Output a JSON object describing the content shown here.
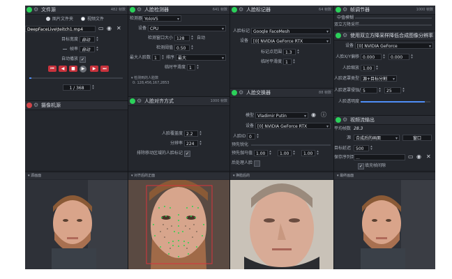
{
  "file_source": {
    "title": "文件源",
    "fps": "482 帧数",
    "radio_folder": "图片文件夹",
    "radio_video": "视频文件",
    "path_value": "DeepFaceLive\\teitch1.mp4",
    "target_width_label": "目标宽度",
    "target_width_value": "自动",
    "fps_label": "帧率",
    "fps_value": "自动",
    "autoplay_label": "自动播放",
    "frame_counter": "1 / 368"
  },
  "camera_source": {
    "title": "摄像机源"
  },
  "face_detector": {
    "title": "人脸检测器",
    "fps": "641 帧数",
    "detector_label": "检测器",
    "detector_value": "YoloV5",
    "device_label": "设备",
    "device_value": "CPU",
    "window_label": "检测窗口大小",
    "window_value": "128",
    "window_auto": "自动",
    "threshold_label": "检测阈值",
    "threshold_value": "0.50",
    "max_faces_label": "最大人脸数",
    "max_faces_value": "1",
    "sort_label": "排序",
    "sort_value": "最大",
    "temporal_label": "临时平滑度",
    "temporal_value": "1",
    "detected_label": "检测到的人脸数",
    "detected_value": "0: 128,456,167,2853"
  },
  "face_aligner": {
    "title": "人脸对齐方式",
    "fps": "1000 帧数",
    "coverage_label": "人脸覆盖度",
    "coverage_value": "2.2",
    "resolution_label": "分辨率",
    "resolution_value": "224",
    "exclude_label": "排除移动区域的人脸标记",
    "aligned_view": "对齐后的正面"
  },
  "face_marker": {
    "title": "人脸标记器",
    "fps": "64 帧数",
    "marker_label": "人脸标记",
    "marker_value": "Google FaceMesh",
    "device_label": "设备",
    "device_value": "[0] NVIDIA GeForce RTX",
    "range_label": "标记点范围",
    "range_value": "1.3",
    "temporal_label": "临时平滑度",
    "temporal_value": "1"
  },
  "face_swapper": {
    "title": "人脸交换器",
    "fps": "88 帧数",
    "model_label": "模型",
    "model_value": "Vladimir Putin",
    "device_label": "设备",
    "device_value": "[0] NVIDIA GeForce RTX",
    "face_id_label": "人脸ID",
    "face_id_value": "0",
    "morph_label": "预先锐化",
    "gamma_label": "预先伽马值",
    "gamma_values": [
      "1.00",
      "1.00",
      "1.00"
    ],
    "post_label": "后处理人脸",
    "swapped_view": "换脸后的"
  },
  "frame_adjuster": {
    "title": "帧调节器",
    "fps": "1000 帧数",
    "median_label": "中值模糊",
    "degrade_label": "双立方降采样",
    "merger_title": "使用双立方降采样降低合成图像分辨率",
    "device_label": "设备",
    "device_value": "[0] NVIDIA GeForce",
    "offset_label": "人脸X/Y偏移",
    "offset_x": "0.000",
    "offset_y": "0.000",
    "scale_label": "人脸缩放",
    "scale_value": "1.00",
    "mask_label": "人脸遮罩类型",
    "mask_value": "源+目标分割",
    "erode_label": "人脸遮罩侵蚀/模糊",
    "erode_value": "5",
    "blur_value": "25",
    "opacity_label": "人脸透明度",
    "opacity_fraction": 0.92
  },
  "stream_output": {
    "title": "视频流输出",
    "avg_fps_label": "平均帧数",
    "avg_fps_value": "28.3",
    "source_label": "源",
    "source_value": "合成后的画面",
    "window_label": "窗口",
    "delay_label": "目标延迟",
    "delay_value": "500",
    "save_label": "保存序列到",
    "save_value": "...",
    "fill_label": "填充帧间隙",
    "merged_view": "最终画面"
  },
  "source_view": "源画面"
}
